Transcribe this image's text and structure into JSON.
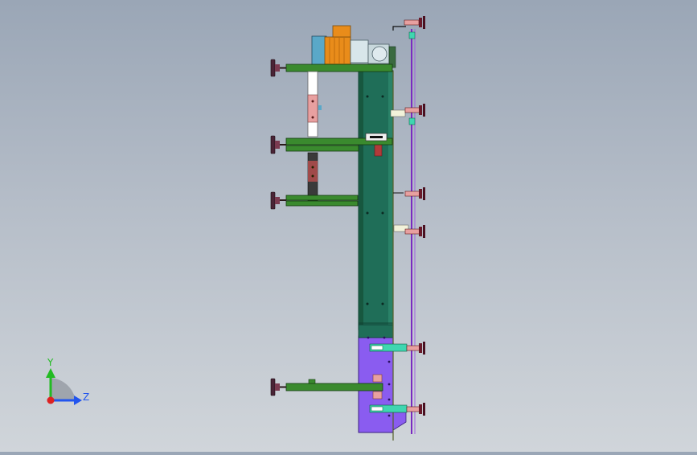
{
  "view": {
    "triad": {
      "y_label": "Y",
      "z_label": "Z"
    },
    "colors": {
      "background_top": "#9aa6b6",
      "background_bottom": "#d0d5da",
      "conveyor_teal": "#1e6e5a",
      "conveyor_purple": "#8a5cf0",
      "support_green": "#3a8a2e",
      "motor_orange": "#e98c1a",
      "adjuster_dark": "#4a2436",
      "guide_rail_purple": "#7a2ac0",
      "clamp_cyan": "#3fd6b0",
      "bracket_pink": "#e8a0a0",
      "triad_y": "#22bb22",
      "triad_z": "#2255ee",
      "triad_x": "#dd2222"
    }
  }
}
